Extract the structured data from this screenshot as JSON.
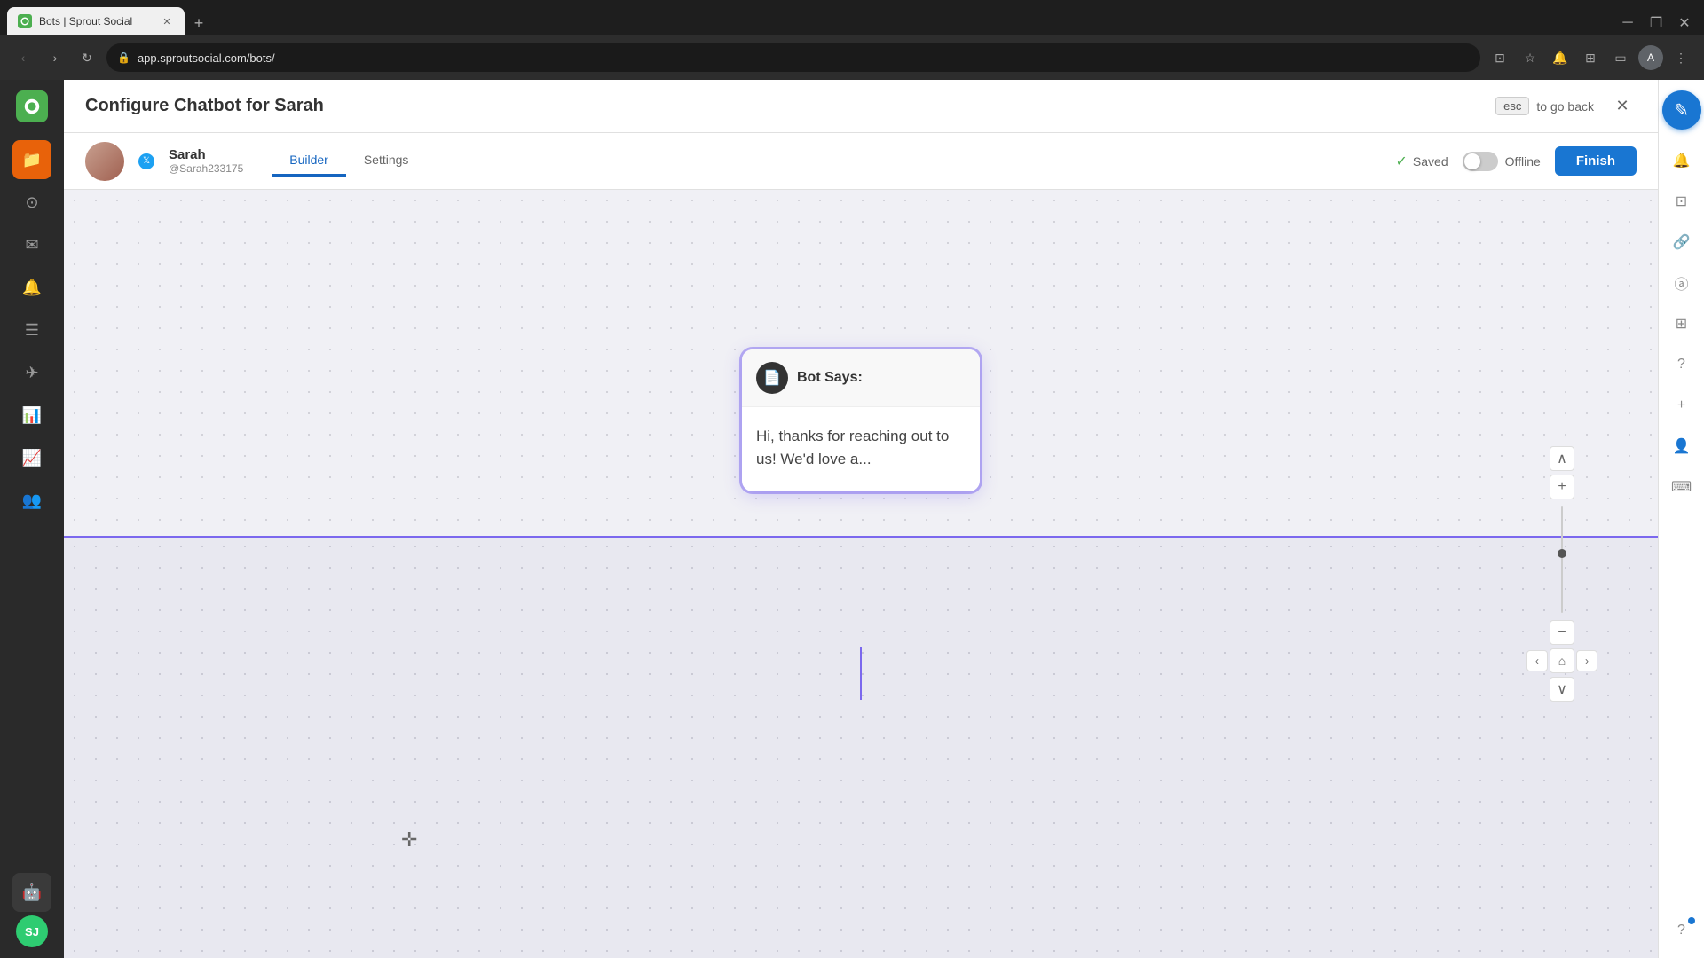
{
  "browser": {
    "tab_title": "Bots | Sprout Social",
    "url": "app.sproutsocial.com/bots/",
    "new_tab_label": "+",
    "back_disabled": false,
    "forward_disabled": true,
    "window_minimize": "─",
    "window_maximize": "❐",
    "window_close": "✕"
  },
  "header": {
    "title": "Configure Chatbot for Sarah",
    "esc_key": "esc",
    "esc_hint": "to go back",
    "close_label": "✕"
  },
  "bot_header": {
    "name": "Sarah",
    "handle": "@Sarah233175",
    "tab_builder": "Builder",
    "tab_settings": "Settings",
    "saved_label": "Saved",
    "offline_label": "Offline",
    "finish_label": "Finish"
  },
  "bot_card": {
    "title": "Bot Says:",
    "body_text": "Hi, thanks for reaching out to us! We'd love a..."
  },
  "zoom_controls": {
    "plus": "+",
    "minus": "−",
    "up": "∧",
    "down": "∨",
    "left": "‹",
    "right": "›",
    "home": "⌂"
  },
  "sidebar": {
    "logo_letter": "",
    "items": [
      {
        "id": "dashboard",
        "icon": "⊙"
      },
      {
        "id": "inbox",
        "icon": "✉"
      },
      {
        "id": "notifications",
        "icon": "🔔"
      },
      {
        "id": "feeds",
        "icon": "☰"
      },
      {
        "id": "publish",
        "icon": "✈"
      },
      {
        "id": "reports",
        "icon": "📊"
      },
      {
        "id": "analytics",
        "icon": "📈"
      },
      {
        "id": "audience",
        "icon": "👥"
      },
      {
        "id": "bots",
        "icon": "🤖"
      }
    ],
    "avatar_text": "SJ"
  },
  "right_panel": {
    "items": [
      {
        "id": "eye",
        "icon": "◎"
      },
      {
        "id": "link",
        "icon": "🔗"
      },
      {
        "id": "at",
        "icon": "ⓐ"
      },
      {
        "id": "grid",
        "icon": "⊞"
      },
      {
        "id": "help",
        "icon": "?"
      },
      {
        "id": "add",
        "icon": "+"
      },
      {
        "id": "users",
        "icon": "👤"
      },
      {
        "id": "keyboard",
        "icon": "⌨"
      },
      {
        "id": "help2",
        "icon": "?"
      }
    ]
  },
  "fab": {
    "icon": "✎"
  }
}
